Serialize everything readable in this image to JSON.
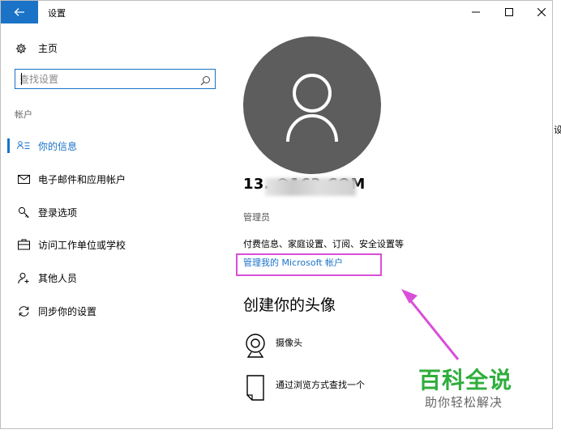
{
  "window": {
    "title": "设置"
  },
  "sidebar": {
    "home_label": "主页",
    "search_placeholder": "查找设置",
    "section_header": "帐户",
    "items": [
      {
        "label": "你的信息",
        "icon": "person-list-icon",
        "active": true
      },
      {
        "label": "电子邮件和应用帐户",
        "icon": "mail-icon"
      },
      {
        "label": "登录选项",
        "icon": "key-icon"
      },
      {
        "label": "访问工作单位或学校",
        "icon": "briefcase-icon"
      },
      {
        "label": "其他人员",
        "icon": "person-add-icon"
      },
      {
        "label": "同步你的设置",
        "icon": "sync-icon"
      }
    ]
  },
  "main": {
    "email": "13.          @163.COM",
    "role": "管理员",
    "description": "付费信息、家庭设置、订阅、安全设置等",
    "manage_link": "管理我的 Microsoft 帐户",
    "create_heading": "创建你的头像",
    "options": [
      {
        "label": "摄像头",
        "icon": "camera-icon"
      },
      {
        "label": "通过浏览方式查找一个",
        "icon": "file-icon"
      }
    ]
  },
  "watermark": {
    "title": "百科全说",
    "subtitle": "助你轻松解决"
  },
  "side_glyph": "设",
  "colors": {
    "accent": "#1a73c7",
    "annotation": "#d94fd9",
    "watermark": "#2fae3c"
  }
}
